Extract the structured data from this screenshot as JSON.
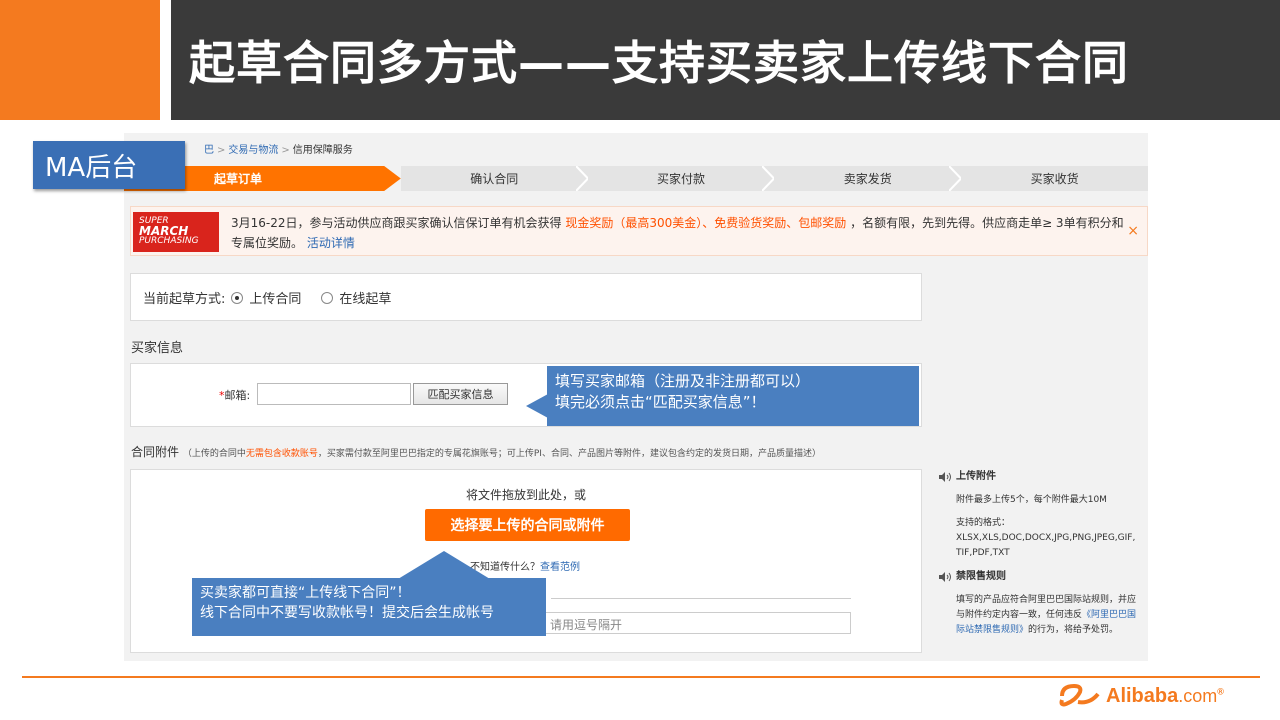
{
  "slide": {
    "title": "起草合同多方式——支持买卖家上传线下合同",
    "badge": "MA后台"
  },
  "breadcrumb": {
    "items": [
      "巴",
      "交易与物流",
      "信用保障服务"
    ],
    "separator": ">"
  },
  "steps": [
    "起草订单",
    "确认合同",
    "买家付款",
    "卖家发货",
    "买家收货"
  ],
  "promo": {
    "logo_top": "SUPER",
    "logo_mid": "MARCH",
    "logo_bot": "PURCHASING",
    "text_1": "3月16-22日，参与活动供应商跟买家确认信保订单有机会获得 ",
    "text_highlight": "现金奖励（最高300美金）、免费验货奖励、包邮奖励",
    "text_2": " ，名额有限，先到先得。供应商走单≥ 3单有积分和专属位奖励。",
    "link": "活动详情",
    "close": "×"
  },
  "draft_mode": {
    "label": "当前起草方式:",
    "option_upload": "上传合同",
    "option_online": "在线起草",
    "selected": "上传合同"
  },
  "buyer_info": {
    "section_title": "买家信息",
    "required_mark": "*",
    "email_label": "邮箱:",
    "email_value": "",
    "match_button": "匹配买家信息"
  },
  "attachment": {
    "section_title": "合同附件",
    "note_prefix": "（上传的合同中",
    "note_warn": "无需包含收款账号",
    "note_suffix": "，买家需付款至阿里巴巴指定的专属花旗账号；可上传PI、合同、产品图片等附件，建议包含约定的发货日期，产品质量描述）",
    "drop_text": "将文件拖放到此处，或",
    "upload_button": "选择要上传的合同或附件",
    "hint_text": "不知道传什么？",
    "hint_link": "查看范例",
    "comma_input_placeholder": "请用逗号隔开"
  },
  "side_info": {
    "upload_title": "上传附件",
    "upload_body": "附件最多上传5个，每个附件最大10M",
    "formats_label": "支持的格式：",
    "formats": "XLSX,XLS,DOC,DOCX,JPG,PNG,JPEG,GIF,TIF,PDF,TXT",
    "rules_title": "禁限售规则",
    "rules_body_1": "填写的产品应符合阿里巴巴国际站规则，并应与附件约定内容一致，任何违反",
    "rules_link": "《阿里巴巴国际站禁限售规则》",
    "rules_body_2": "的行为，将给予处罚。"
  },
  "callouts": {
    "email_line1": "填写买家邮箱（注册及非注册都可以）",
    "email_line2": "填完必须点击“匹配买家信息”！",
    "upload_line1": "买卖家都可直接“上传线下合同”！",
    "upload_line2": "线下合同中不要写收款帐号！提交后会生成帐号"
  },
  "footer": {
    "brand": "Alibaba",
    "brand_suffix": ".com",
    "registered": "®"
  },
  "colors": {
    "accent_orange": "#f47a1f",
    "title_bar": "#3a3a3a",
    "callout_blue": "#4a7fc0",
    "button_orange": "#ff6a00"
  }
}
